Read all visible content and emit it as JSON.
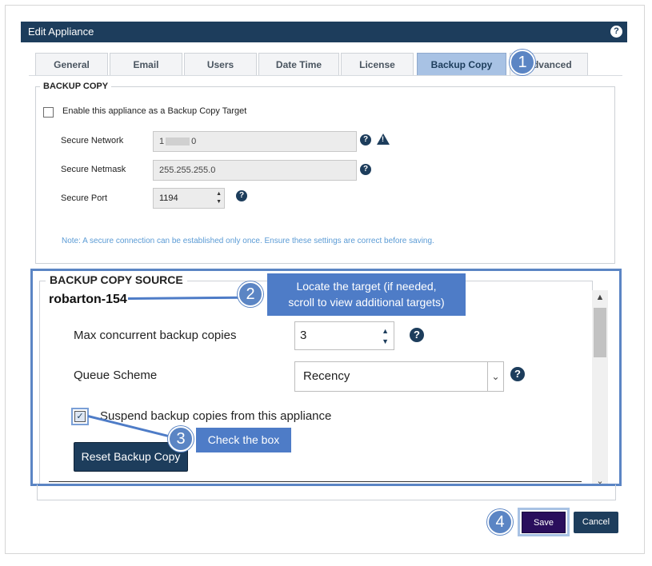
{
  "window": {
    "title": "Edit Appliance",
    "help_icon": "question-circle-icon"
  },
  "tabs": [
    {
      "label": "General",
      "active": false
    },
    {
      "label": "Email",
      "active": false
    },
    {
      "label": "Users",
      "active": false
    },
    {
      "label": "Date Time",
      "active": false
    },
    {
      "label": "License",
      "active": false
    },
    {
      "label": "Backup Copy",
      "active": true
    },
    {
      "label": "Advanced",
      "active": false
    }
  ],
  "backup_copy": {
    "legend": "BACKUP COPY",
    "enable_label": "Enable this appliance as a Backup Copy Target",
    "enable_checked": false,
    "secure_network_label": "Secure Network",
    "secure_network_value": "1",
    "secure_network_value_end": "0",
    "secure_netmask_label": "Secure Netmask",
    "secure_netmask_value": "255.255.255.0",
    "secure_port_label": "Secure Port",
    "secure_port_value": "1194",
    "note": "Note: A secure connection can be established only once. Ensure these settings are correct before saving."
  },
  "source": {
    "legend": "BACKUP COPY SOURCE",
    "target_name": "robarton-154",
    "max_label": "Max concurrent backup copies",
    "max_value": "3",
    "queue_label": "Queue Scheme",
    "queue_value": "Recency",
    "suspend_label": "Suspend backup copies from this appliance",
    "suspend_checked": true,
    "reset_label": "Reset Backup Copy"
  },
  "footer": {
    "save_label": "Save",
    "cancel_label": "Cancel"
  },
  "annotations": {
    "step1": "1",
    "step2": "2",
    "step2_text_line1": "Locate the target (if needed,",
    "step2_text_line2": "scroll to view additional targets)",
    "step3": "3",
    "step3_text": "Check the box",
    "step4": "4"
  },
  "colors": {
    "header": "#1d3d5c",
    "accent": "#5b85c4",
    "save": "#2a0e5c",
    "note": "#5b9bd5"
  }
}
